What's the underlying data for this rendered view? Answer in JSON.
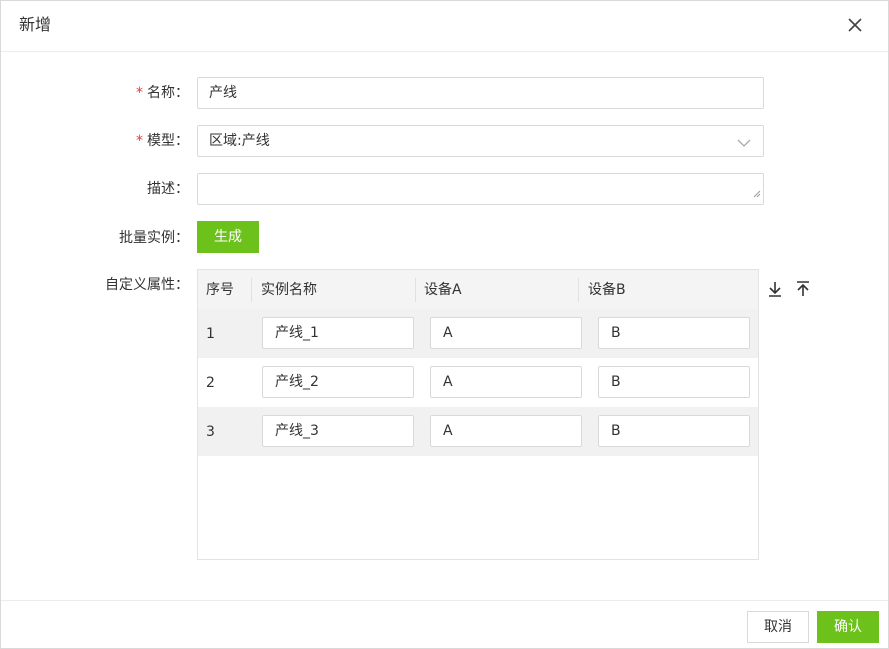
{
  "dialog": {
    "title": "新增",
    "close_icon": "close-icon"
  },
  "form": {
    "name": {
      "label": "名称：",
      "required_mark": "*",
      "value": "产线"
    },
    "model": {
      "label": "模型：",
      "required_mark": "*",
      "value": "区域:产线",
      "arrow_icon": "chevron-down-icon"
    },
    "description": {
      "label": "描述：",
      "value": ""
    },
    "batch": {
      "label": "批量实例：",
      "button_label": "生成"
    },
    "custom_props": {
      "label": "自定义属性："
    }
  },
  "table": {
    "columns": [
      "序号",
      "实例名称",
      "设备A",
      "设备B"
    ],
    "rows": [
      {
        "index": "1",
        "name": "产线_1",
        "device_a": "A",
        "device_b": "B"
      },
      {
        "index": "2",
        "name": "产线_2",
        "device_a": "A",
        "device_b": "B"
      },
      {
        "index": "3",
        "name": "产线_3",
        "device_a": "A",
        "device_b": "B"
      }
    ],
    "tools": [
      "download-icon",
      "upload-icon"
    ]
  },
  "footer": {
    "cancel_label": "取消",
    "confirm_label": "确认"
  },
  "colors": {
    "accent": "#6cc21b",
    "required": "#e4393c",
    "border": "#d9d9d9"
  }
}
